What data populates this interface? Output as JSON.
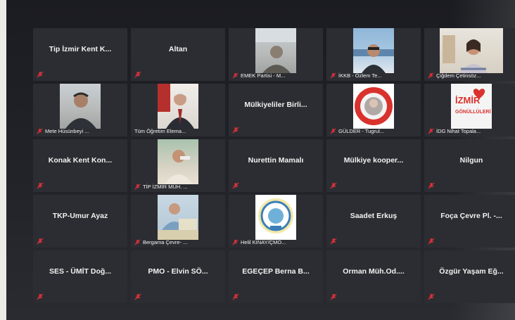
{
  "meeting": {
    "participants": [
      {
        "name": "Tip İzmir Kent K...",
        "display": "name"
      },
      {
        "name": "Altan",
        "display": "name"
      },
      {
        "name": "EMEK Partisi - M...",
        "display": "video",
        "scene": "room"
      },
      {
        "name": "İKKB - Özlem Te...",
        "display": "video",
        "scene": "sea"
      },
      {
        "name": "Çiğdem Çetinsöz...",
        "display": "video",
        "scene": "home"
      },
      {
        "name": "Mete Hüsünbeyi ...",
        "display": "video",
        "scene": "room"
      },
      {
        "name": "Tüm Öğretim Elema...",
        "display": "video",
        "scene": "flag"
      },
      {
        "name": "Mülkiyeliler Birli...",
        "display": "name"
      },
      {
        "name": "GÜLDER - Tugrul...",
        "display": "video",
        "scene": "logo-red"
      },
      {
        "name": "İDG Nihat Topala...",
        "display": "video",
        "scene": "logo-izmir"
      },
      {
        "name": "Konak Kent Kon...",
        "display": "name"
      },
      {
        "name": "TİP İZMİR MÜH. ...",
        "display": "video",
        "scene": "outdoor"
      },
      {
        "name": "Nurettin Mamalı",
        "display": "name"
      },
      {
        "name": "Mülkiye kooper...",
        "display": "name"
      },
      {
        "name": "Nilgun",
        "display": "name"
      },
      {
        "name": "TKP-Umur Ayaz",
        "display": "name"
      },
      {
        "name": "Bergama Çevre- ...",
        "display": "video",
        "scene": "blue"
      },
      {
        "name": "Helil KINAY/ÇMO...",
        "display": "video",
        "scene": "logo-round"
      },
      {
        "name": "Saadet Erkuş",
        "display": "name"
      },
      {
        "name": "Foça Çevre Pl. -...",
        "display": "name"
      },
      {
        "name": "SES - ÜMİT  Doğ...",
        "display": "name"
      },
      {
        "name": "PMO - Elvin SÖ...",
        "display": "name"
      },
      {
        "name": "EGEÇEP Berna B...",
        "display": "name"
      },
      {
        "name": "Orman  Müh.Od....",
        "display": "name"
      },
      {
        "name": "Özgür Yaşam Eğ...",
        "display": "name"
      }
    ],
    "logo_texts": {
      "izmir": "İZMİR",
      "gonulluleri": "GÖNÜLLÜLERİ"
    }
  },
  "colors": {
    "muted_mic": "#e0313a",
    "tile_bg": "#2c2d32",
    "name_text": "#f2f2f2"
  }
}
